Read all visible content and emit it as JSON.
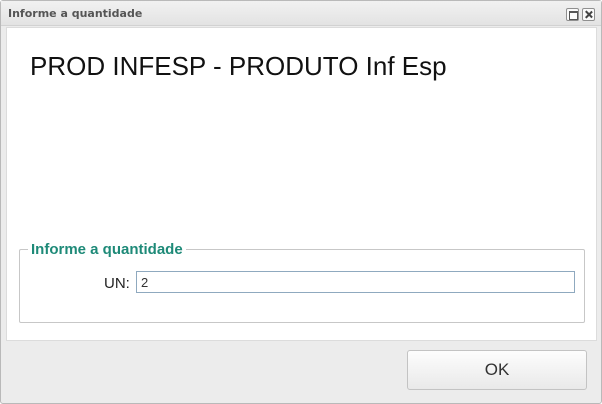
{
  "window": {
    "title": "Informe a quantidade"
  },
  "product": {
    "name": "PROD INFESP - PRODUTO Inf Esp"
  },
  "quantity_group": {
    "legend": "Informe a quantidade",
    "unit_label": "UN:",
    "value": "2"
  },
  "actions": {
    "ok_label": "OK"
  },
  "colors": {
    "legend": "#1e8a78",
    "input_border": "#8fa9bf"
  }
}
